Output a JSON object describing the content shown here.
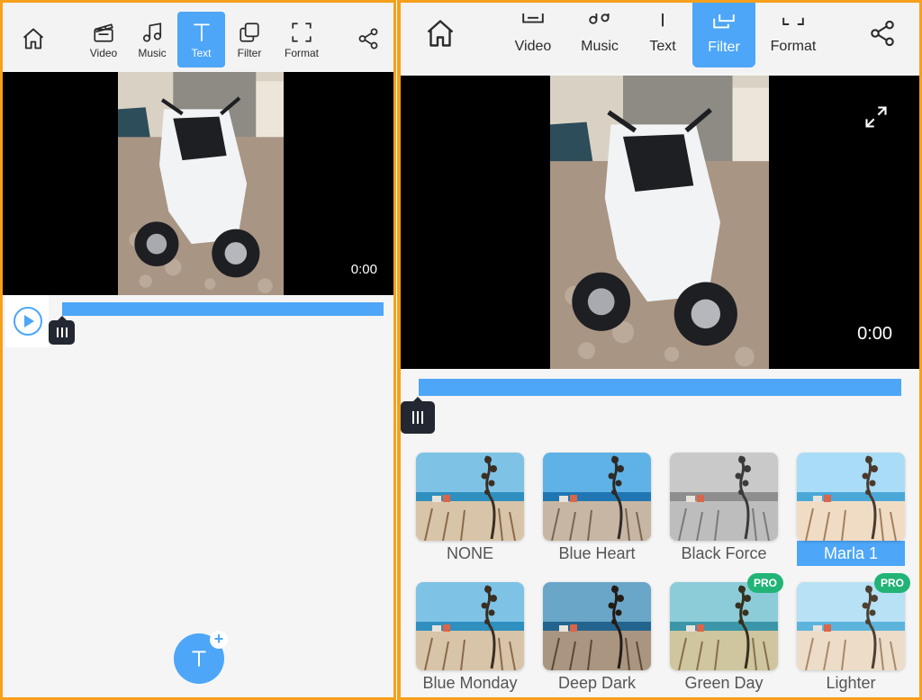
{
  "left_panel": {
    "toolbar": {
      "home_icon": "home-icon",
      "share_icon": "share-icon",
      "items": [
        {
          "label": "Video",
          "icon": "clapperboard-icon",
          "active": false
        },
        {
          "label": "Music",
          "icon": "music-note-icon",
          "active": false
        },
        {
          "label": "Text",
          "icon": "text-icon",
          "active": true
        },
        {
          "label": "Filter",
          "icon": "filter-icon",
          "active": false
        },
        {
          "label": "Format",
          "icon": "format-icon",
          "active": false
        }
      ]
    },
    "video": {
      "timecode": "0:00"
    },
    "timeline": {
      "play_icon": "play-icon",
      "handle_icon": "drag-handle-icon"
    },
    "fab": {
      "icon": "add-text-icon"
    }
  },
  "right_panel": {
    "toolbar": {
      "home_icon": "home-icon",
      "share_icon": "share-icon",
      "items": [
        {
          "label": "Video",
          "icon": "clapperboard-icon",
          "active": false
        },
        {
          "label": "Music",
          "icon": "music-note-icon",
          "active": false
        },
        {
          "label": "Text",
          "icon": "text-icon",
          "active": false
        },
        {
          "label": "Filter",
          "icon": "filter-icon",
          "active": true
        },
        {
          "label": "Format",
          "icon": "format-icon",
          "active": false
        }
      ]
    },
    "video": {
      "timecode": "0:00",
      "expand_icon": "expand-icon"
    },
    "timeline": {
      "handle_icon": "drag-handle-icon"
    },
    "filters": [
      {
        "name": "NONE",
        "selected": false,
        "pro": false,
        "tone": "normal"
      },
      {
        "name": "Blue Heart",
        "selected": false,
        "pro": false,
        "tone": "blue"
      },
      {
        "name": "Black Force",
        "selected": false,
        "pro": false,
        "tone": "mono"
      },
      {
        "name": "Marla 1",
        "selected": true,
        "pro": false,
        "tone": "bright"
      },
      {
        "name": "Blue Monday",
        "selected": false,
        "pro": false,
        "tone": "normal"
      },
      {
        "name": "Deep Dark",
        "selected": false,
        "pro": false,
        "tone": "dark"
      },
      {
        "name": "Green Day",
        "selected": false,
        "pro": true,
        "tone": "green"
      },
      {
        "name": "Lighter",
        "selected": false,
        "pro": true,
        "tone": "light"
      }
    ],
    "pro_badge": "PRO"
  },
  "colors": {
    "accent": "#4da6f7",
    "border": "#f7a01b",
    "pro_badge": "#22b477",
    "handle": "#222732"
  }
}
